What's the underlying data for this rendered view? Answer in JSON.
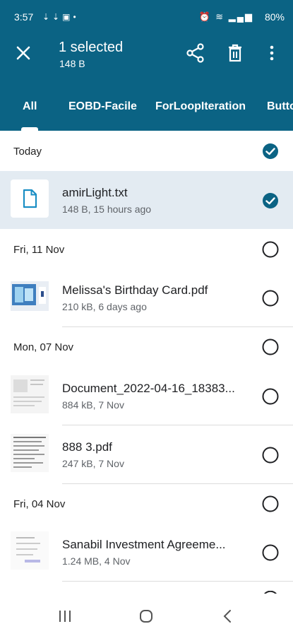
{
  "status": {
    "time": "3:57",
    "battery": "80%"
  },
  "selection": {
    "title": "1 selected",
    "size": "148 B"
  },
  "tabs": [
    "All",
    "EOBD-Facile",
    "ForLoopIteration",
    "Butto"
  ],
  "sections": [
    {
      "label": "Today",
      "files": [
        {
          "name": "amirLight.txt",
          "meta": "148 B, 15 hours ago",
          "selected": true
        }
      ]
    },
    {
      "label": "Fri, 11 Nov",
      "files": [
        {
          "name": "Melissa's Birthday Card.pdf",
          "meta": "210 kB, 6 days ago",
          "selected": false
        }
      ]
    },
    {
      "label": "Mon, 07 Nov",
      "files": [
        {
          "name": "Document_2022-04-16_18383...",
          "meta": "884 kB, 7 Nov",
          "selected": false
        },
        {
          "name": "888 3.pdf",
          "meta": "247 kB, 7 Nov",
          "selected": false
        }
      ]
    },
    {
      "label": "Fri, 04 Nov",
      "files": [
        {
          "name": "Sanabil  Investment Agreeme...",
          "meta": "1.24 MB, 4 Nov",
          "selected": false
        }
      ]
    }
  ],
  "colors": {
    "header": "#0b6384",
    "selected_row": "#e3ebf2",
    "check": "#0b6384"
  }
}
